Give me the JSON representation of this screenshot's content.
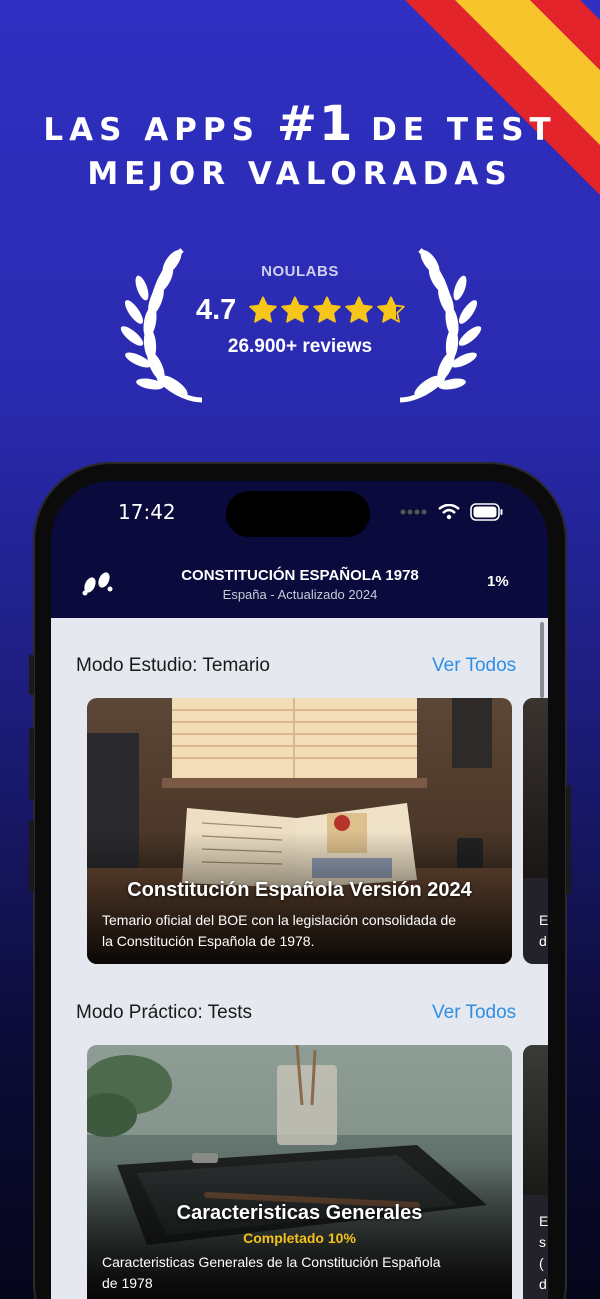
{
  "headline": {
    "line1_prefix": "LAS APPS",
    "line1_highlight": "#1",
    "line1_suffix": "DE TEST",
    "line2": "MEJOR VALORADAS"
  },
  "rating": {
    "brand": "NOULABS",
    "value": "4.7",
    "stars_out_of_5": 4.7,
    "reviews": "26.900+ reviews"
  },
  "status_bar": {
    "time": "17:42",
    "icons": [
      "signal-dots-icon",
      "wifi-icon",
      "battery-icon"
    ]
  },
  "app_header": {
    "title": "CONSTITUCIÓN ESPAÑOLA 1978",
    "subtitle": "España - Actualizado 2024",
    "progress": "1%",
    "left_icon": "footprints-icon"
  },
  "sections": [
    {
      "title": "Modo Estudio: Temario",
      "see_all": "Ver Todos",
      "card": {
        "title": "Constitución Española Versión 2024",
        "description_line1": "Temario oficial del BOE con la legislación consolidada de",
        "description_line2": "la Constitución Española de 1978."
      },
      "peek": {
        "line1": "E",
        "line2": "d"
      }
    },
    {
      "title": "Modo Práctico: Tests",
      "see_all": "Ver Todos",
      "card": {
        "title": "Caracteristicas Generales",
        "badge": "Completado 10%",
        "description_line1": "Caracteristicas Generales de la Constitución Española",
        "description_line2": "de 1978"
      },
      "peek": {
        "line1": "E",
        "line2": "s",
        "line3": "(",
        "line4": "d"
      }
    }
  ],
  "colors": {
    "background_top": "#2f2fc2",
    "background_bottom": "#05051a",
    "accent_link": "#2d8fe6",
    "badge": "#f3c21a",
    "star": "#f5c518",
    "flag_red": "#e3242b",
    "flag_yellow": "#f7c52b"
  }
}
